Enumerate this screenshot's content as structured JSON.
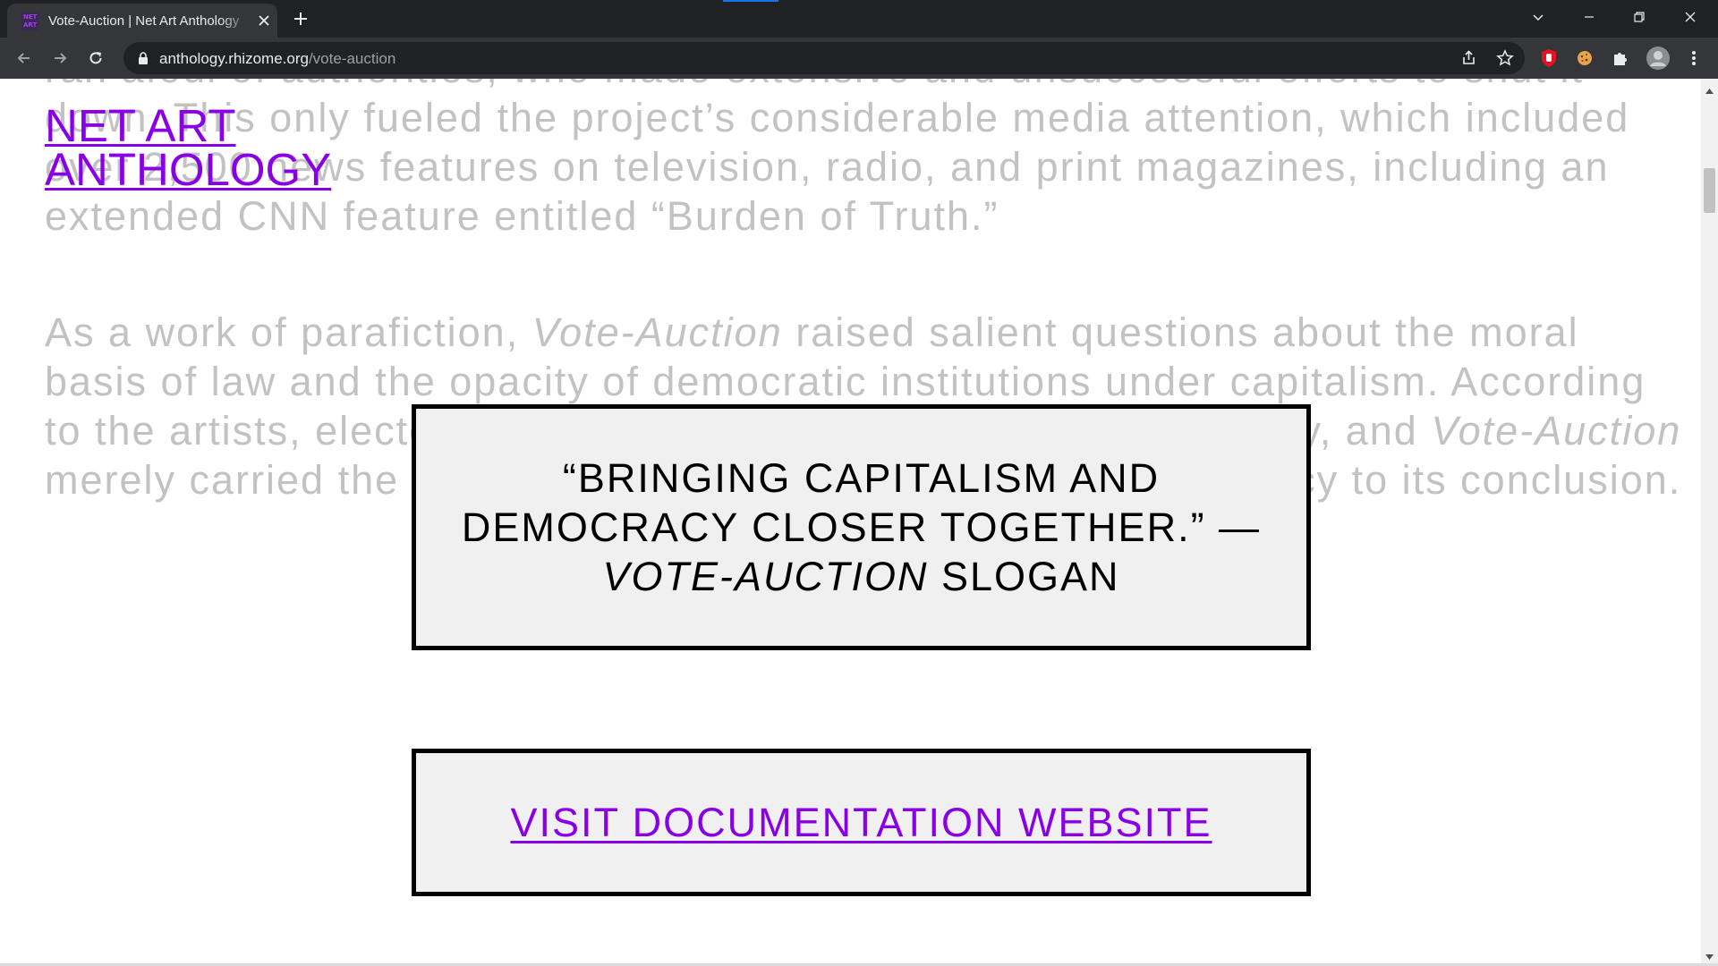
{
  "browser": {
    "tab_title": "Vote-Auction | Net Art Anthology",
    "favicon_text": "NET ART",
    "url_host": "anthology.rhizome.org",
    "url_path": "/vote-auction"
  },
  "page": {
    "logo_line1": "NET ART",
    "logo_line2": "ANTHOLOGY",
    "paragraph1": "ran afoul of authorities, who made extensive and unsuccessful efforts to shut it down. This only fueled the project’s considerable media attention, which included over 2,500 news features on television, radio, and print magazines, including an extended CNN feature entitled “Burden of Truth.”",
    "paragraph2_a": "As a work of parafiction, ",
    "paragraph2_em1": "Vote-Auction",
    "paragraph2_b": " raised salient questions about the moral basis of law and the opacity of democratic institutions under capitalism. According to the artists, electoral systems were already corrupted by money, and ",
    "paragraph2_em2": "Vote-Auction",
    "paragraph2_c": " merely carried the relationship between capitalism and democracy to its conclusion.",
    "quote_main": "“Bringing capitalism and democracy closer together.” —",
    "quote_em": "Vote-Auction",
    "quote_tail": " slogan",
    "visit_link": "Visit documentation website"
  },
  "colors": {
    "link_purple": "#8a00e6",
    "body_text_gray": "#c2c2c2",
    "box_fill": "#f0f0f0",
    "chrome_dark": "#202124",
    "chrome_toolbar": "#35363a"
  },
  "icons": [
    "tab-close-icon",
    "new-tab-icon",
    "dropdown-icon",
    "minimize-icon",
    "restore-icon",
    "close-window-icon",
    "back-icon",
    "forward-icon",
    "reload-icon",
    "lock-icon",
    "share-icon",
    "bookmark-star-icon",
    "adblock-extension-icon",
    "cookie-extension-icon",
    "puzzle-extensions-icon",
    "profile-avatar",
    "kebab-menu-icon"
  ]
}
